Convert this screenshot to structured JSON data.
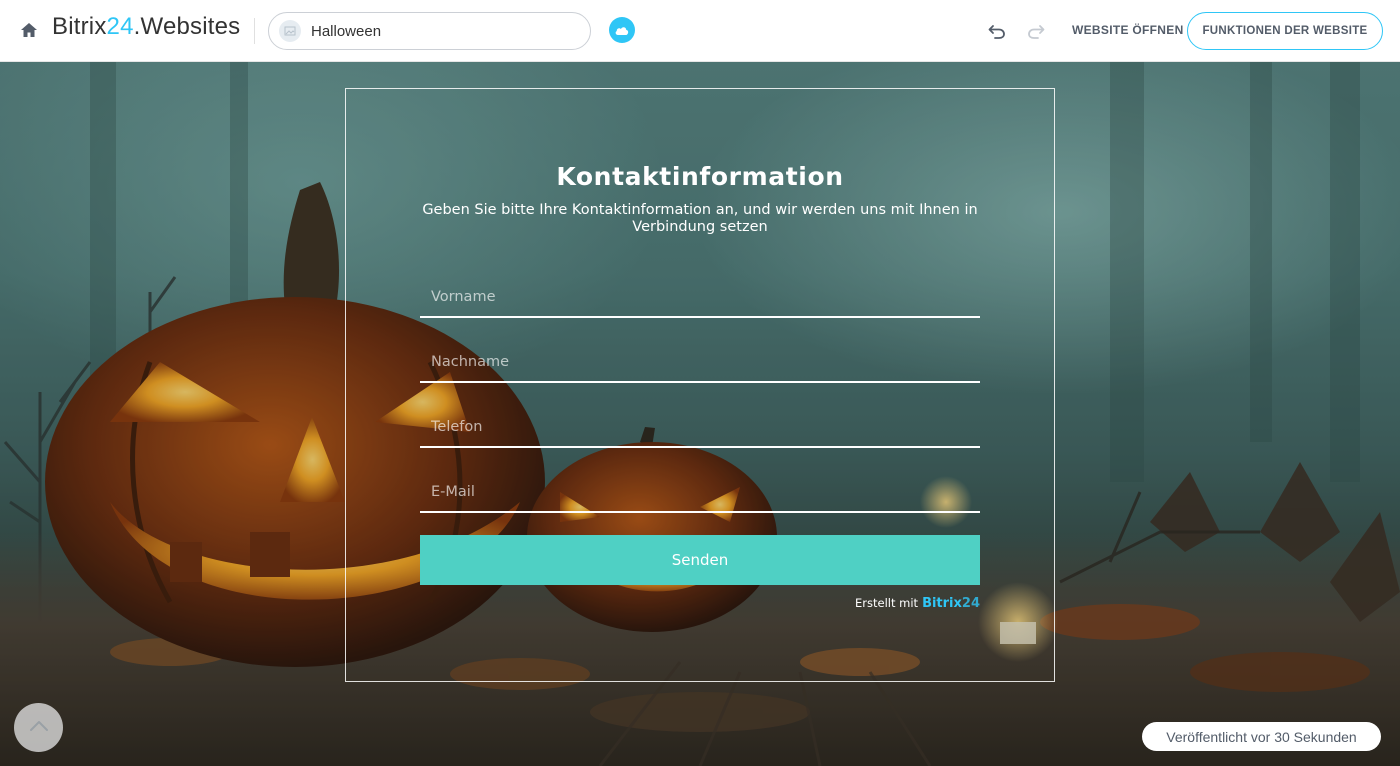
{
  "header": {
    "logo_main": "Bitrix",
    "logo_num": "24",
    "logo_suffix": ".Websites",
    "site_name": "Halloween",
    "open_site_label": "WEBSITE ÖFFNEN",
    "site_functions_label": "FUNKTIONEN DER WEBSITE"
  },
  "form": {
    "title": "Kontaktinformation",
    "subtitle": "Geben Sie bitte Ihre Kontaktinformation an, und wir werden uns mit Ihnen in Verbindung setzen",
    "fields": [
      {
        "placeholder": "Vorname",
        "value": ""
      },
      {
        "placeholder": "Nachname",
        "value": ""
      },
      {
        "placeholder": "Telefon",
        "value": ""
      },
      {
        "placeholder": "E-Mail",
        "value": ""
      }
    ],
    "submit_label": "Senden",
    "made_with_label": "Erstellt mit",
    "made_with_brand": "Bitrix",
    "made_with_brand_num": "24"
  },
  "status": {
    "published_label": "Veröffentlicht vor 30 Sekunden"
  },
  "colors": {
    "accent": "#2fc6f6",
    "submit_button": "#4fd0c4"
  },
  "icons": [
    "home-icon",
    "site-thumbnail-icon",
    "cloud-icon",
    "undo-icon",
    "redo-icon",
    "arrow-up-icon"
  ]
}
